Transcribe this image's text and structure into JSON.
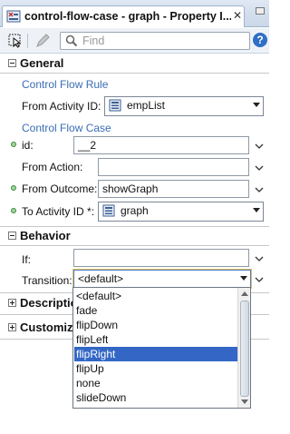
{
  "tab": {
    "title": "control-flow-case - graph - Property I..."
  },
  "toolbar": {
    "search_placeholder": "Find",
    "help_label": "?"
  },
  "general": {
    "header": "General",
    "rule_heading": "Control Flow Rule",
    "from_activity_label": "From Activity ID:",
    "from_activity_value": "empList",
    "case_heading": "Control Flow Case",
    "id_label": "id:",
    "id_value": "__2",
    "from_action_label": "From Action:",
    "from_action_value": "",
    "from_outcome_label": "From Outcome:",
    "from_outcome_value": "showGraph",
    "to_activity_label": "To Activity ID *:",
    "to_activity_value": "graph"
  },
  "behavior": {
    "header": "Behavior",
    "if_label": "If:",
    "if_value": "",
    "transition_label": "Transition:",
    "transition_value": "<default>",
    "transition_options": [
      "<default>",
      "fade",
      "flipDown",
      "flipLeft",
      "flipRight",
      "flipUp",
      "none",
      "slideDown"
    ],
    "highlighted_option": "flipRight"
  },
  "collapsed_sections": [
    "Description",
    "Customizat"
  ],
  "colors": {
    "accent": "#3467c5",
    "subheading": "#3a6db5",
    "required_dot": "#9ed49e"
  }
}
